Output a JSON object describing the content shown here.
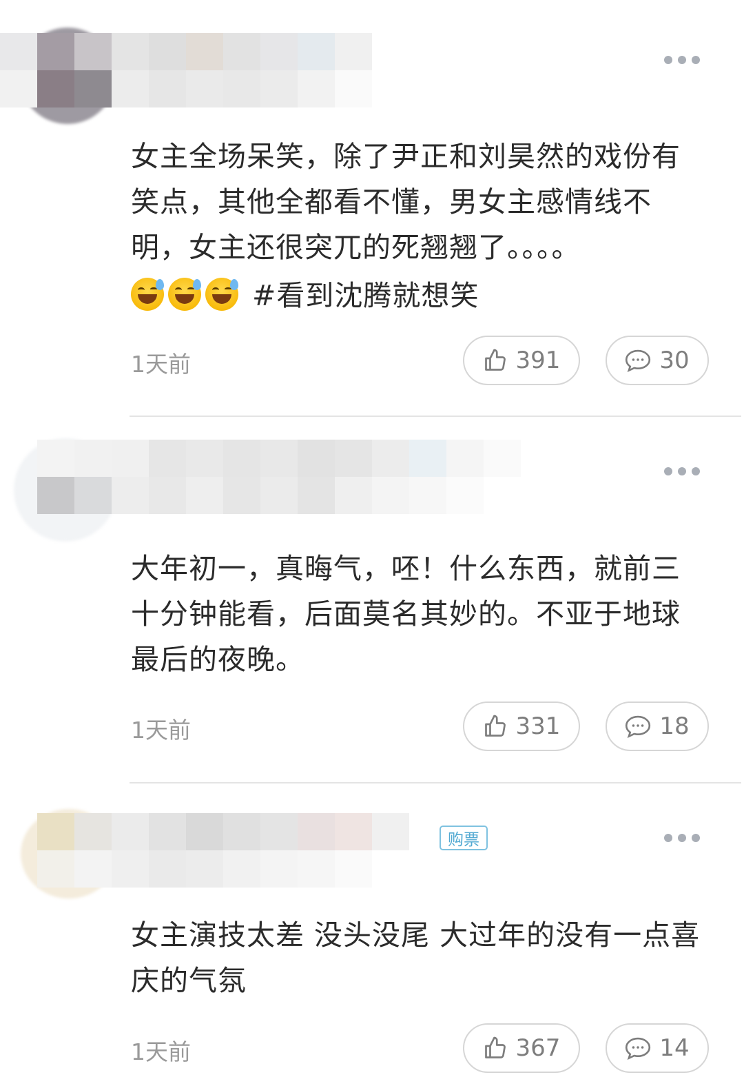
{
  "comments": [
    {
      "text": "女主全场呆笑，除了尹正和刘昊然的戏份有笑点，其他全都看不懂，男女主感情线不明，女主还很突兀的死翘翘了。。。。",
      "emoji_names": [
        "grinning-sweat-emoji",
        "grinning-sweat-emoji",
        "grinning-sweat-emoji"
      ],
      "hashtag": "#看到沈腾就想笑",
      "time": "1天前",
      "likes": "391",
      "replies": "30"
    },
    {
      "text": "大年初一，真晦气，呸！什么东西，就前三十分钟能看，后面莫名其妙的。不亚于地球最后的夜晚。",
      "time": "1天前",
      "likes": "331",
      "replies": "18"
    },
    {
      "text": "女主演技太差 没头没尾 大过年的没有一点喜庆的气氛",
      "badge": "购票",
      "time": "1天前",
      "likes": "367",
      "replies": "14"
    }
  ],
  "icons": {
    "more": "more-dots-icon",
    "like": "thumbs-up-icon",
    "reply": "comment-bubble-icon"
  },
  "colors": {
    "muted_text": "#9a9a9a",
    "pill_border": "#d6d6d6",
    "badge": "#52a9d2"
  }
}
